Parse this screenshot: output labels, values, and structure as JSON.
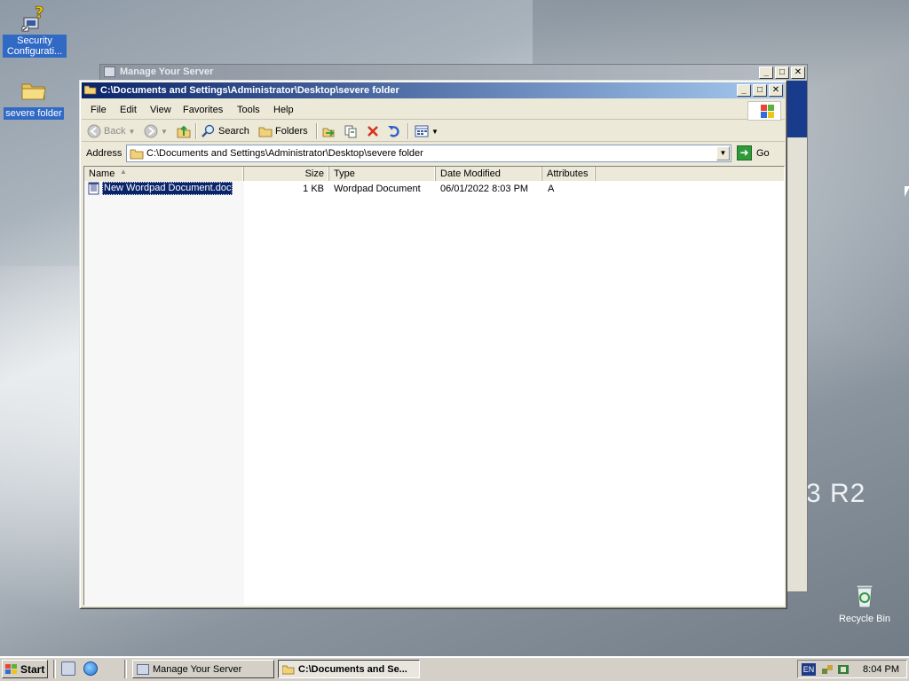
{
  "desktop": {
    "icons": [
      {
        "label": "Security Configurati...",
        "selected": true
      },
      {
        "label": "severe folder",
        "selected": true
      },
      {
        "label": "Recycle Bin",
        "selected": false
      }
    ],
    "brand_text": "3 R2"
  },
  "back_window": {
    "title": "Manage Your Server"
  },
  "explorer": {
    "title": "C:\\Documents and Settings\\Administrator\\Desktop\\severe folder",
    "menu": [
      "File",
      "Edit",
      "View",
      "Favorites",
      "Tools",
      "Help"
    ],
    "toolbar": {
      "back": "Back",
      "search": "Search",
      "folders": "Folders"
    },
    "address": {
      "label": "Address",
      "value": "C:\\Documents and Settings\\Administrator\\Desktop\\severe folder",
      "go": "Go"
    },
    "columns": [
      "Name",
      "Size",
      "Type",
      "Date Modified",
      "Attributes"
    ],
    "files": [
      {
        "name": "New Wordpad Document.doc",
        "size": "1 KB",
        "type": "Wordpad Document",
        "modified": "06/01/2022 8:03 PM",
        "attributes": "A"
      }
    ]
  },
  "taskbar": {
    "start": "Start",
    "tasks": [
      {
        "label": "Manage Your Server",
        "active": false
      },
      {
        "label": "C:\\Documents and Se...",
        "active": true
      }
    ],
    "language": "EN",
    "clock": "8:04 PM"
  },
  "colors": {
    "title_active": "#0a246a",
    "title_inactive": "#8d96a1",
    "selection": "#316ac5",
    "face": "#ece9d8"
  }
}
